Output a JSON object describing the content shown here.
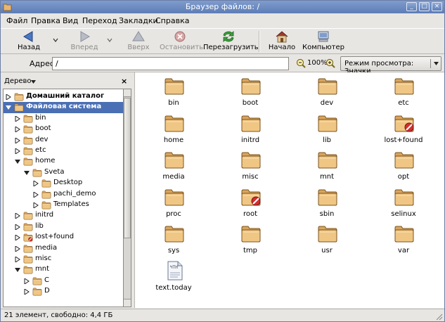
{
  "window": {
    "title": "Браузер файлов: /",
    "buttons": [
      "_",
      "□",
      "×"
    ]
  },
  "menu": [
    "Файл",
    "Правка",
    "Вид",
    "Переход",
    "Закладки",
    "Справка"
  ],
  "toolbar": {
    "back": "Назад",
    "forward": "Вперед",
    "up": "Вверх",
    "stop": "Остановить",
    "reload": "Перезагрузить",
    "home": "Начало",
    "computer": "Компьютер"
  },
  "address": {
    "label": "Адрес:",
    "value": "/",
    "zoom": "100%",
    "view_mode": "Режим просмотра: Значки"
  },
  "sidebar": {
    "title": "Дерево",
    "close": "×",
    "tree": [
      {
        "label": "Домашний каталог",
        "bold": true
      },
      {
        "label": "Файловая система",
        "bold": true,
        "selected": true
      },
      {
        "label": "bin"
      },
      {
        "label": "boot"
      },
      {
        "label": "dev"
      },
      {
        "label": "etc"
      },
      {
        "label": "home"
      },
      {
        "label": "Sveta"
      },
      {
        "label": "Desktop"
      },
      {
        "label": "pachi_demo"
      },
      {
        "label": "Templates"
      },
      {
        "label": "initrd"
      },
      {
        "label": "lib"
      },
      {
        "label": "lost+found"
      },
      {
        "label": "media"
      },
      {
        "label": "misc"
      },
      {
        "label": "mnt"
      },
      {
        "label": "C"
      },
      {
        "label": "D"
      }
    ]
  },
  "files": [
    {
      "name": "bin"
    },
    {
      "name": "boot"
    },
    {
      "name": "dev"
    },
    {
      "name": "etc"
    },
    {
      "name": "home"
    },
    {
      "name": "initrd"
    },
    {
      "name": "lib"
    },
    {
      "name": "lost+found",
      "locked": true
    },
    {
      "name": "media"
    },
    {
      "name": "misc"
    },
    {
      "name": "mnt"
    },
    {
      "name": "opt"
    },
    {
      "name": "proc"
    },
    {
      "name": "root",
      "locked": true
    },
    {
      "name": "sbin"
    },
    {
      "name": "selinux"
    },
    {
      "name": "sys"
    },
    {
      "name": "tmp"
    },
    {
      "name": "usr"
    },
    {
      "name": "var"
    },
    {
      "name": "text.today",
      "type": "file",
      "badge": "ЧТН"
    }
  ],
  "status": "21 элемент, свободно: 4,4 ГБ",
  "colors": {
    "titlebar": "#5d7db6",
    "selection": "#4a6fb4",
    "folder": "#e9b571"
  }
}
